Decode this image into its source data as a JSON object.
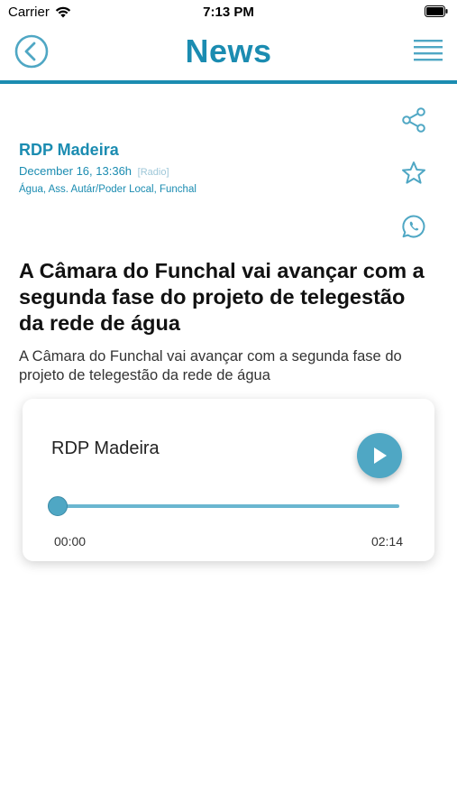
{
  "status_bar": {
    "carrier": "Carrier",
    "time": "7:13 PM"
  },
  "header": {
    "title": "News",
    "back_icon": "back-arrow-circle-icon",
    "menu_icon": "hamburger-menu-icon",
    "accent_color": "#1b8cb1"
  },
  "article": {
    "source": "RDP Madeira",
    "date": "December 16, 13:36h",
    "type": "[Radio]",
    "tags": "Água, Ass. Autár/Poder Local, Funchal",
    "headline": "A Câmara do Funchal vai avançar com a segunda fase do projeto de telegestão da rede de água",
    "lead": "A Câmara do Funchal vai avançar com a segunda fase do projeto de telegestão da rede de água"
  },
  "actions": {
    "share_icon": "share-icon",
    "favorite_icon": "star-icon",
    "whatsapp_icon": "whatsapp-icon"
  },
  "player": {
    "title": "RDP Madeira",
    "current_time": "00:00",
    "total_time": "02:14",
    "progress": 0,
    "play_icon": "play-icon"
  }
}
